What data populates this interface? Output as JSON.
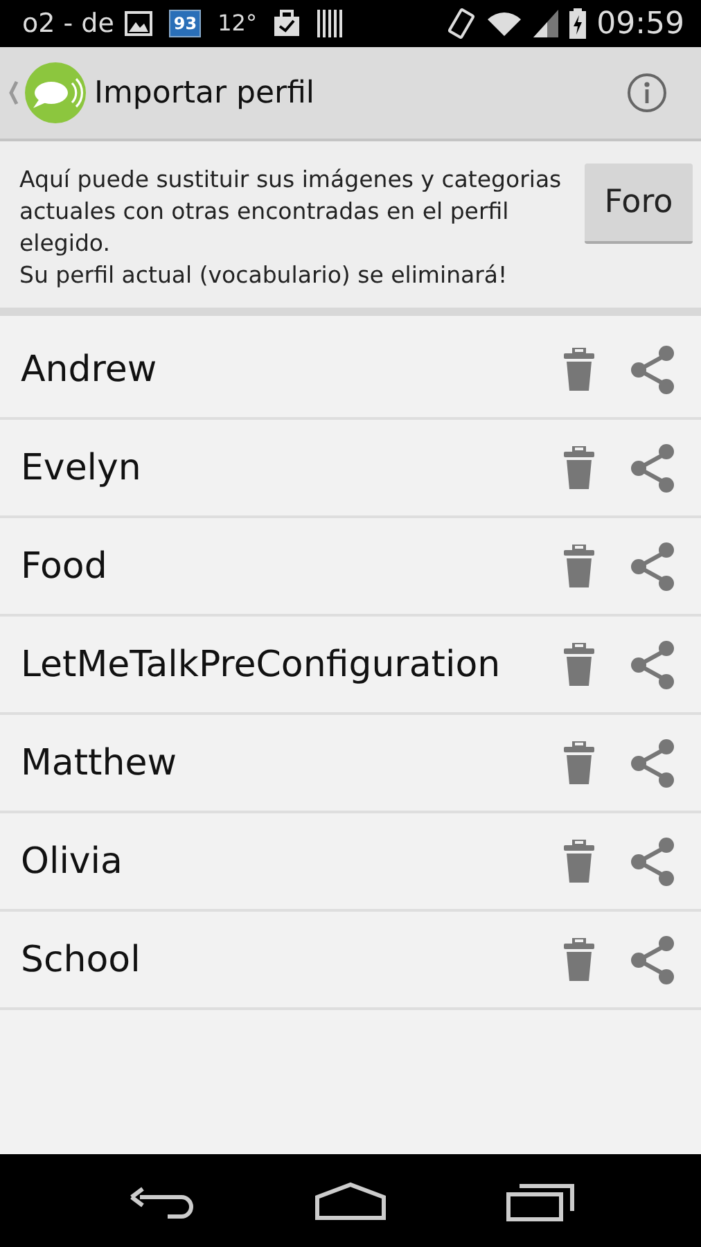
{
  "status_bar": {
    "carrier": "o2 - de",
    "badge": "93",
    "temperature": "12°",
    "time": "09:59"
  },
  "action_bar": {
    "title": "Importar perfil"
  },
  "info": {
    "lines": [
      "Aquí puede sustituir sus imágenes y categorias actuales con otras encontradas en el perfil elegido.",
      "Su perfil actual (vocabulario) se eliminará!"
    ],
    "button": "Foro"
  },
  "profiles": [
    {
      "name": "Andrew"
    },
    {
      "name": "Evelyn"
    },
    {
      "name": "Food"
    },
    {
      "name": "LetMeTalkPreConfiguration"
    },
    {
      "name": "Matthew"
    },
    {
      "name": "Olivia"
    },
    {
      "name": "School"
    }
  ]
}
